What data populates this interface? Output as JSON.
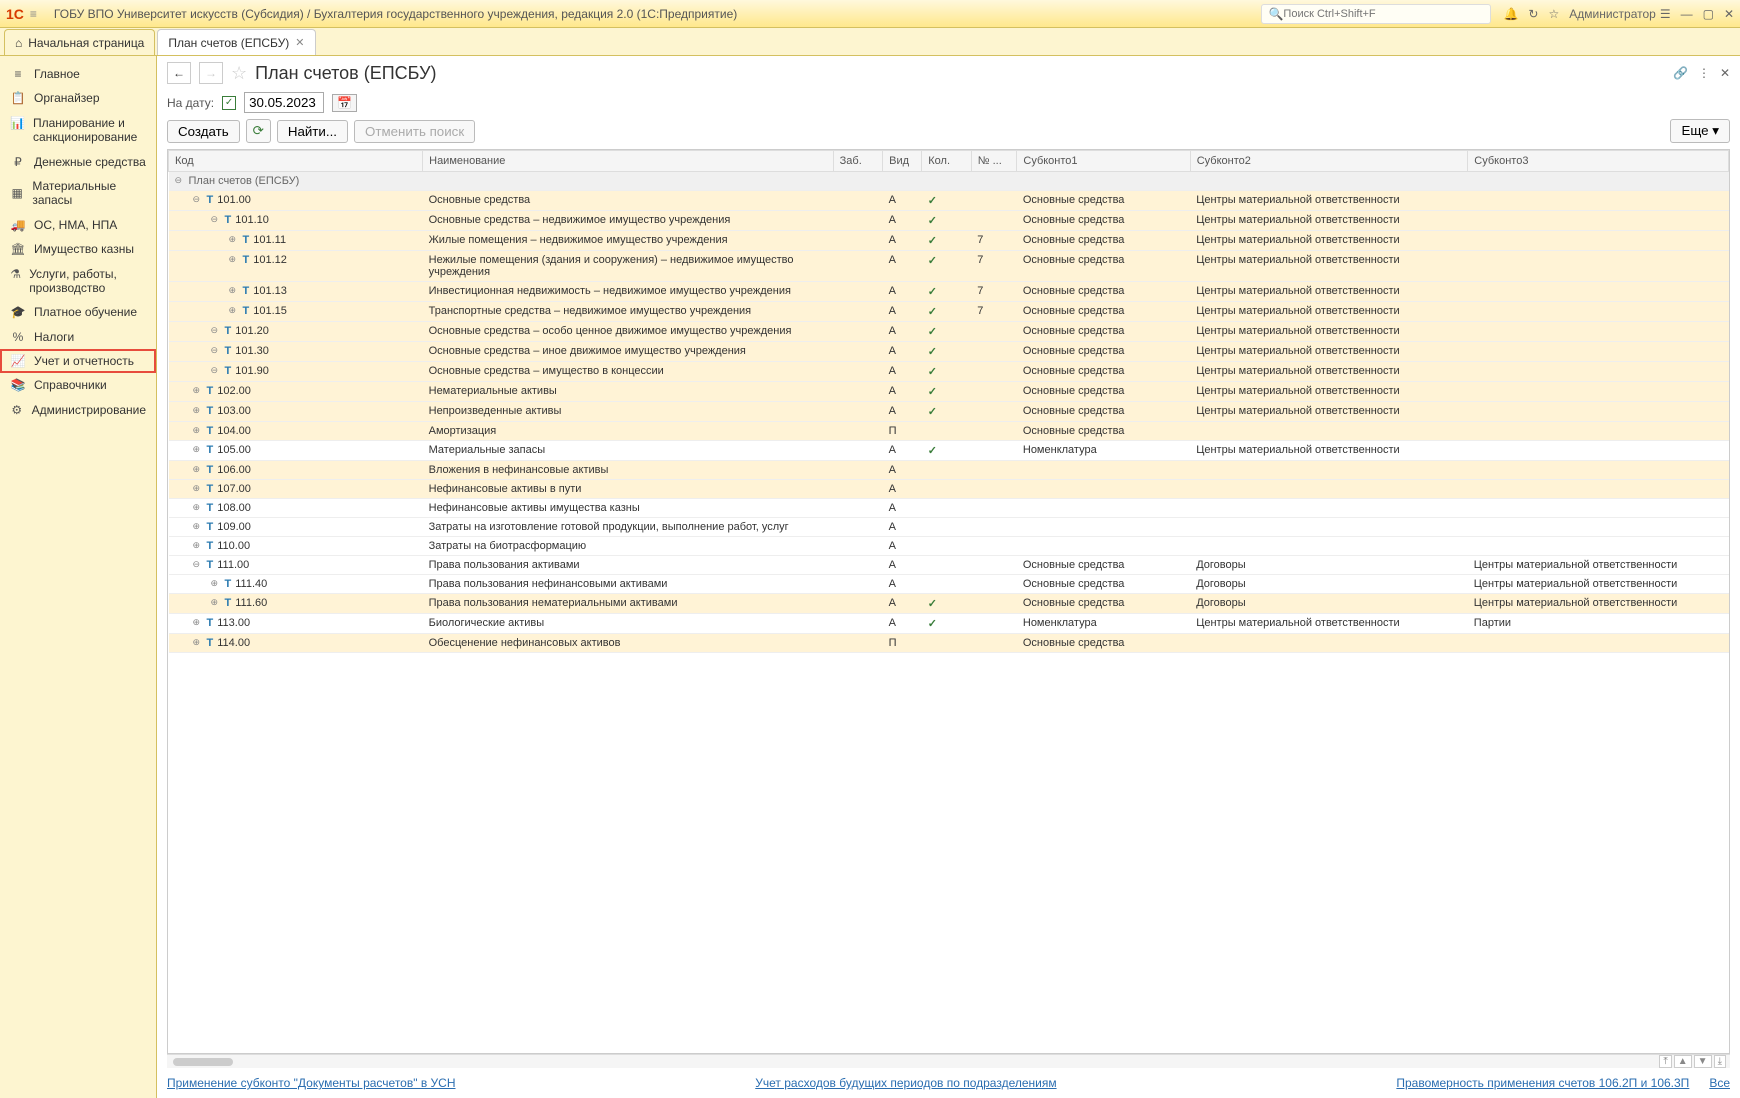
{
  "topbar": {
    "title": "ГОБУ ВПО Университет искусств (Субсидия) / Бухгалтерия государственного учреждения, редакция 2.0  (1С:Предприятие)",
    "search_placeholder": "Поиск Ctrl+Shift+F",
    "admin": "Администратор"
  },
  "tabs": {
    "home": "Начальная страница",
    "active": "План счетов (ЕПСБУ)"
  },
  "sidebar": [
    {
      "label": "Главное"
    },
    {
      "label": "Органайзер"
    },
    {
      "label": "Планирование и санкционирование"
    },
    {
      "label": "Денежные средства"
    },
    {
      "label": "Материальные запасы"
    },
    {
      "label": "ОС, НМА, НПА"
    },
    {
      "label": "Имущество казны"
    },
    {
      "label": "Услуги, работы, производство"
    },
    {
      "label": "Платное обучение"
    },
    {
      "label": "Налоги"
    },
    {
      "label": "Учет и отчетность"
    },
    {
      "label": "Справочники"
    },
    {
      "label": "Администрирование"
    }
  ],
  "sidebar_selected_index": 10,
  "page": {
    "title": "План счетов (ЕПСБУ)",
    "date_label": "На дату:",
    "date_value": "30.05.2023",
    "create": "Создать",
    "find": "Найти...",
    "cancel_find": "Отменить поиск",
    "more": "Еще"
  },
  "columns": {
    "code": "Код",
    "name": "Наименование",
    "zab": "Заб.",
    "vid": "Вид",
    "kol": "Кол.",
    "no": "№ ...",
    "s1": "Субконто1",
    "s2": "Субконто2",
    "s3": "Субконто3"
  },
  "group_header": "План счетов (ЕПСБУ)",
  "rows": [
    {
      "indent": 1,
      "exp": "⊖",
      "code": "101.00",
      "name": "Основные средства",
      "vid": "А",
      "chk": true,
      "kol": "",
      "no": "",
      "s1": "Основные средства",
      "s2": "Центры материальной ответственности",
      "s3": "",
      "hl": true
    },
    {
      "indent": 2,
      "exp": "⊖",
      "code": "101.10",
      "name": "Основные средства – недвижимое имущество учреждения",
      "vid": "А",
      "chk": true,
      "kol": "",
      "no": "",
      "s1": "Основные средства",
      "s2": "Центры материальной ответственности",
      "s3": "",
      "hl": true
    },
    {
      "indent": 3,
      "exp": "⊕",
      "code": "101.11",
      "name": "Жилые помещения – недвижимое имущество учреждения",
      "vid": "А",
      "chk": true,
      "kol": "",
      "no": "7",
      "s1": "Основные средства",
      "s2": "Центры материальной ответственности",
      "s3": "",
      "hl": true
    },
    {
      "indent": 3,
      "exp": "⊕",
      "code": "101.12",
      "name": "Нежилые помещения (здания и сооружения) – недвижимое имущество учреждения",
      "vid": "А",
      "chk": true,
      "kol": "",
      "no": "7",
      "s1": "Основные средства",
      "s2": "Центры материальной ответственности",
      "s3": "",
      "hl": true
    },
    {
      "indent": 3,
      "exp": "⊕",
      "code": "101.13",
      "name": "Инвестиционная недвижимость – недвижимое имущество учреждения",
      "vid": "А",
      "chk": true,
      "kol": "",
      "no": "7",
      "s1": "Основные средства",
      "s2": "Центры материальной ответственности",
      "s3": "",
      "hl": true
    },
    {
      "indent": 3,
      "exp": "⊕",
      "code": "101.15",
      "name": "Транспортные средства – недвижимое имущество учреждения",
      "vid": "А",
      "chk": true,
      "kol": "",
      "no": "7",
      "s1": "Основные средства",
      "s2": "Центры материальной ответственности",
      "s3": "",
      "hl": true
    },
    {
      "indent": 2,
      "exp": "⊖",
      "code": "101.20",
      "name": "Основные средства – особо ценное движимое имущество учреждения",
      "vid": "А",
      "chk": true,
      "kol": "",
      "no": "",
      "s1": "Основные средства",
      "s2": "Центры материальной ответственности",
      "s3": "",
      "hl": true
    },
    {
      "indent": 2,
      "exp": "⊖",
      "code": "101.30",
      "name": "Основные средства –  иное движимое имущество учреждения",
      "vid": "А",
      "chk": true,
      "kol": "",
      "no": "",
      "s1": "Основные средства",
      "s2": "Центры материальной ответственности",
      "s3": "",
      "hl": true
    },
    {
      "indent": 2,
      "exp": "⊖",
      "code": "101.90",
      "name": "Основные средства – имущество в концессии",
      "vid": "А",
      "chk": true,
      "kol": "",
      "no": "",
      "s1": "Основные средства",
      "s2": "Центры материальной ответственности",
      "s3": "",
      "hl": true
    },
    {
      "indent": 1,
      "exp": "⊕",
      "code": "102.00",
      "name": "Нематериальные активы",
      "vid": "А",
      "chk": true,
      "kol": "",
      "no": "",
      "s1": "Основные средства",
      "s2": "Центры материальной ответственности",
      "s3": "",
      "hl": true
    },
    {
      "indent": 1,
      "exp": "⊕",
      "code": "103.00",
      "name": "Непроизведенные активы",
      "vid": "А",
      "chk": true,
      "kol": "",
      "no": "",
      "s1": "Основные средства",
      "s2": "Центры материальной ответственности",
      "s3": "",
      "hl": true
    },
    {
      "indent": 1,
      "exp": "⊕",
      "code": "104.00",
      "name": "Амортизация",
      "vid": "П",
      "chk": false,
      "kol": "",
      "no": "",
      "s1": "Основные средства",
      "s2": "",
      "s3": "",
      "hl": true
    },
    {
      "indent": 1,
      "exp": "⊕",
      "code": "105.00",
      "name": "Материальные запасы",
      "vid": "А",
      "chk": true,
      "kol": "",
      "no": "",
      "s1": "Номенклатура",
      "s2": "Центры материальной ответственности",
      "s3": "",
      "hl": false
    },
    {
      "indent": 1,
      "exp": "⊕",
      "code": "106.00",
      "name": "Вложения в нефинансовые активы",
      "vid": "А",
      "chk": false,
      "kol": "",
      "no": "",
      "s1": "",
      "s2": "",
      "s3": "",
      "hl": true
    },
    {
      "indent": 1,
      "exp": "⊕",
      "code": "107.00",
      "name": "Нефинансовые активы в пути",
      "vid": "А",
      "chk": false,
      "kol": "",
      "no": "",
      "s1": "",
      "s2": "",
      "s3": "",
      "hl": true
    },
    {
      "indent": 1,
      "exp": "⊕",
      "code": "108.00",
      "name": "Нефинансовые активы имущества казны",
      "vid": "А",
      "chk": false,
      "kol": "",
      "no": "",
      "s1": "",
      "s2": "",
      "s3": "",
      "hl": false
    },
    {
      "indent": 1,
      "exp": "⊕",
      "code": "109.00",
      "name": "Затраты на изготовление готовой продукции, выполнение работ, услуг",
      "vid": "А",
      "chk": false,
      "kol": "",
      "no": "",
      "s1": "",
      "s2": "",
      "s3": "",
      "hl": false
    },
    {
      "indent": 1,
      "exp": "⊕",
      "code": "110.00",
      "name": "Затраты на биотрасформацию",
      "vid": "А",
      "chk": false,
      "kol": "",
      "no": "",
      "s1": "",
      "s2": "",
      "s3": "",
      "hl": false
    },
    {
      "indent": 1,
      "exp": "⊖",
      "code": "111.00",
      "name": "Права пользования активами",
      "vid": "А",
      "chk": false,
      "kol": "",
      "no": "",
      "s1": "Основные средства",
      "s2": "Договоры",
      "s3": "Центры материальной ответственности",
      "hl": false
    },
    {
      "indent": 2,
      "exp": "⊕",
      "code": "111.40",
      "name": "Права пользования нефинансовыми активами",
      "vid": "А",
      "chk": false,
      "kol": "",
      "no": "",
      "s1": "Основные средства",
      "s2": "Договоры",
      "s3": "Центры материальной ответственности",
      "hl": false
    },
    {
      "indent": 2,
      "exp": "⊕",
      "code": "111.60",
      "name": "Права пользования нематериальными активами",
      "vid": "А",
      "chk": true,
      "kol": "",
      "no": "",
      "s1": "Основные средства",
      "s2": "Договоры",
      "s3": "Центры материальной ответственности",
      "hl": true
    },
    {
      "indent": 1,
      "exp": "⊕",
      "code": "113.00",
      "name": "Биологические активы",
      "vid": "А",
      "chk": true,
      "kol": "",
      "no": "",
      "s1": "Номенклатура",
      "s2": "Центры материальной ответственности",
      "s3": "Партии",
      "hl": false
    },
    {
      "indent": 1,
      "exp": "⊕",
      "code": "114.00",
      "name": "Обесценение нефинансовых активов",
      "vid": "П",
      "chk": false,
      "kol": "",
      "no": "",
      "s1": "Основные средства",
      "s2": "",
      "s3": "",
      "hl": true
    }
  ],
  "footer": {
    "left": "Применение субконто \"Документы расчетов\" в УСН",
    "mid": "Учет расходов будущих периодов по подразделениям",
    "right": "Правомерность применения счетов 106.2П и 106.3П",
    "all": "Все"
  }
}
